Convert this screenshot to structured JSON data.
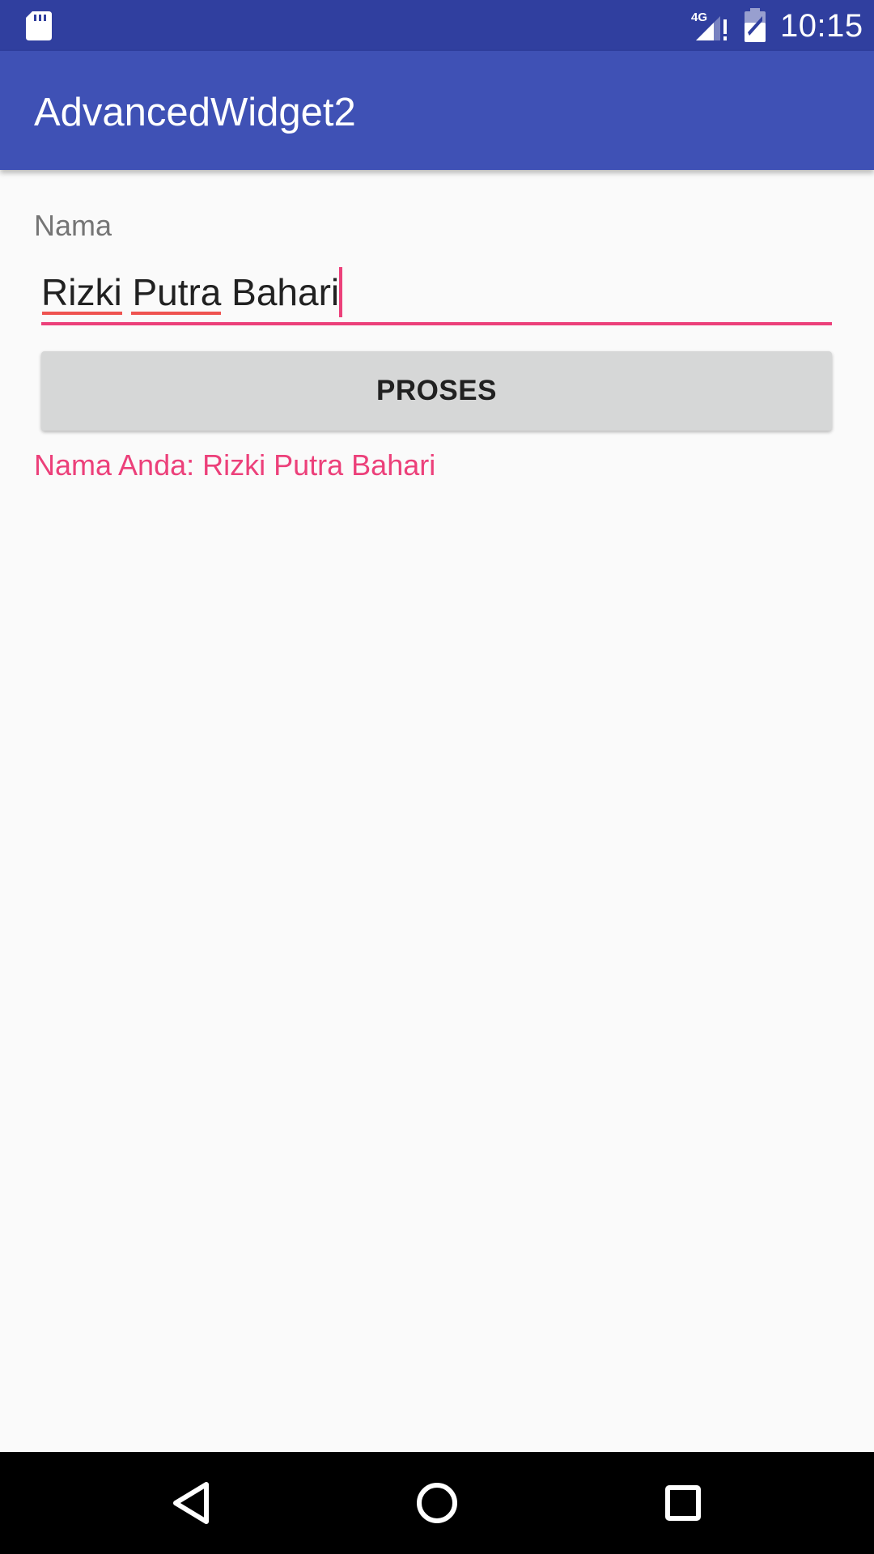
{
  "status_bar": {
    "time": "10:15",
    "network": "4G",
    "icons": [
      "sd-card-icon",
      "signal-icon",
      "battery-icon"
    ]
  },
  "app_bar": {
    "title": "AdvancedWidget2"
  },
  "form": {
    "name_label": "Nama",
    "name_value": "Rizki Putra Bahari",
    "button_label": "PROSES",
    "result": "Nama Anda: Rizki Putra Bahari"
  },
  "nav_bar": {
    "icons": [
      "back-icon",
      "home-icon",
      "recents-icon"
    ]
  },
  "colors": {
    "status_bar": "#303f9f",
    "app_bar": "#3f51b5",
    "accent": "#ec407a",
    "background": "#fafafa",
    "button": "#d6d7d7"
  }
}
